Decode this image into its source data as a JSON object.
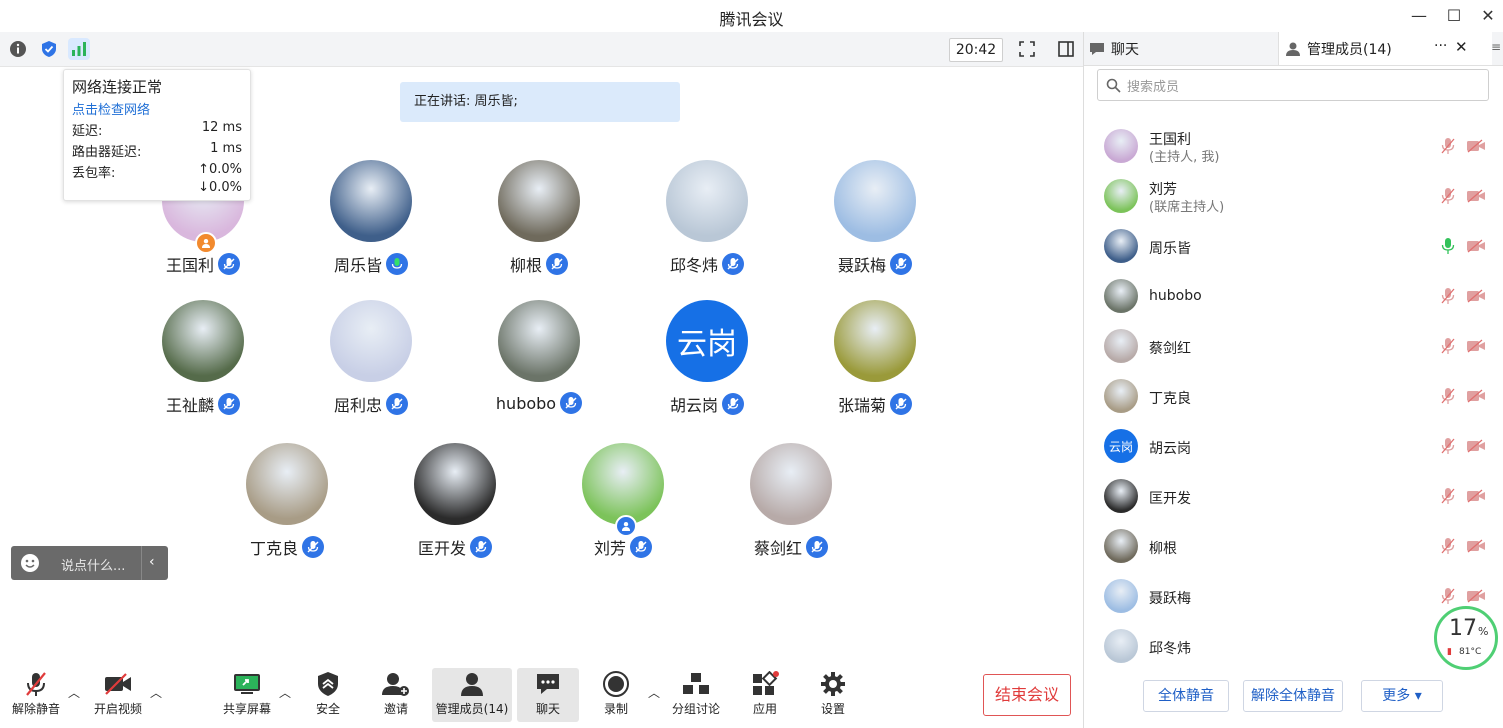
{
  "window": {
    "title": "腾讯会议",
    "minimize": "—",
    "maximize": "☐",
    "close": "✕"
  },
  "meeting": {
    "clock": "20:42",
    "speaker_label": "正在讲话: 周乐皆;",
    "network": {
      "title": "网络连接正常",
      "check_link": "点击检查网络",
      "latency_label": "延迟:",
      "latency_value": "12 ms",
      "router_label": "路由器延迟:",
      "router_value": "1 ms",
      "loss_label": "丢包率:",
      "loss_up": "↑0.0%",
      "loss_down": "↓0.0%"
    },
    "participants": [
      {
        "name": "王国利",
        "role_badge": "host",
        "mic": "muted",
        "avatar_color": "#d9b7dd",
        "avatar_letter": ""
      },
      {
        "name": "周乐皆",
        "role_badge": "",
        "mic": "speaking",
        "avatar_color": "#3f5f8a",
        "avatar_letter": ""
      },
      {
        "name": "柳根",
        "role_badge": "",
        "mic": "muted",
        "avatar_color": "#6f6a5c",
        "avatar_letter": ""
      },
      {
        "name": "邱冬炜",
        "role_badge": "",
        "mic": "muted",
        "avatar_color": "#b9c7d6",
        "avatar_letter": ""
      },
      {
        "name": "聂跃梅",
        "role_badge": "",
        "mic": "muted",
        "avatar_color": "#9dbde3",
        "avatar_letter": ""
      },
      {
        "name": "王祉麟",
        "role_badge": "",
        "mic": "muted",
        "avatar_color": "#556b4a",
        "avatar_letter": ""
      },
      {
        "name": "屈利忠",
        "role_badge": "",
        "mic": "muted",
        "avatar_color": "#c8cfe6",
        "avatar_letter": ""
      },
      {
        "name": "hubobo",
        "role_badge": "",
        "mic": "muted",
        "avatar_color": "#6b7468",
        "avatar_letter": ""
      },
      {
        "name": "胡云岗",
        "role_badge": "",
        "mic": "muted",
        "avatar_color": "#1670e6",
        "avatar_letter": "云岗"
      },
      {
        "name": "张瑞菊",
        "role_badge": "",
        "mic": "muted",
        "avatar_color": "#9a9a3a",
        "avatar_letter": ""
      },
      {
        "name": "丁克良",
        "role_badge": "",
        "mic": "muted",
        "avatar_color": "#a89c86",
        "avatar_letter": ""
      },
      {
        "name": "匡开发",
        "role_badge": "",
        "mic": "muted",
        "avatar_color": "#2b2b2b",
        "avatar_letter": ""
      },
      {
        "name": "刘芳",
        "role_badge": "cohost",
        "mic": "muted",
        "avatar_color": "#7cc35a",
        "avatar_letter": ""
      },
      {
        "name": "蔡剑红",
        "role_badge": "",
        "mic": "muted",
        "avatar_color": "#b7aaa8",
        "avatar_letter": ""
      }
    ],
    "chat_placeholder": "说点什么..."
  },
  "toolbar": {
    "unmute": "解除静音",
    "video": "开启视频",
    "share": "共享屏幕",
    "security": "安全",
    "invite": "邀请",
    "members": "管理成员(14)",
    "chat": "聊天",
    "record": "录制",
    "breakout": "分组讨论",
    "apps": "应用",
    "settings": "设置",
    "end": "结束会议"
  },
  "panel": {
    "tab_chat": "聊天",
    "tab_members": "管理成员(14)",
    "more": "···",
    "close": "✕",
    "menu": "≡",
    "search_placeholder": "搜索成员",
    "members": [
      {
        "name": "王国利",
        "role": "(主持人, 我)",
        "mic": "muted",
        "avatar_color": "#c9a9d4",
        "avatar_letter": ""
      },
      {
        "name": "刘芳",
        "role": "(联席主持人)",
        "mic": "muted",
        "avatar_color": "#7cc35a",
        "avatar_letter": ""
      },
      {
        "name": "周乐皆",
        "role": "",
        "mic": "on",
        "avatar_color": "#3f5f8a",
        "avatar_letter": ""
      },
      {
        "name": "hubobo",
        "role": "",
        "mic": "muted",
        "avatar_color": "#6b7468",
        "avatar_letter": ""
      },
      {
        "name": "蔡剑红",
        "role": "",
        "mic": "muted",
        "avatar_color": "#b7aaa8",
        "avatar_letter": ""
      },
      {
        "name": "丁克良",
        "role": "",
        "mic": "muted",
        "avatar_color": "#a89c86",
        "avatar_letter": ""
      },
      {
        "name": "胡云岗",
        "role": "",
        "mic": "muted",
        "avatar_color": "#1670e6",
        "avatar_letter": "云岗"
      },
      {
        "name": "匡开发",
        "role": "",
        "mic": "muted",
        "avatar_color": "#2b2b2b",
        "avatar_letter": ""
      },
      {
        "name": "柳根",
        "role": "",
        "mic": "muted",
        "avatar_color": "#6f6a5c",
        "avatar_letter": ""
      },
      {
        "name": "聂跃梅",
        "role": "",
        "mic": "muted",
        "avatar_color": "#9dbde3",
        "avatar_letter": ""
      },
      {
        "name": "邱冬炜",
        "role": "",
        "mic": "muted",
        "avatar_color": "#b9c7d6",
        "avatar_letter": ""
      }
    ],
    "mute_all": "全体静音",
    "unmute_all": "解除全体静音",
    "more_btn": "更多 ▾"
  },
  "cpu": {
    "percent": "17",
    "unit": "%",
    "temp": "81°C"
  },
  "colors": {
    "accent": "#2f74e6",
    "end": "#e03b3b",
    "speaking": "#33c25a",
    "muted": "#e0a0a0"
  }
}
